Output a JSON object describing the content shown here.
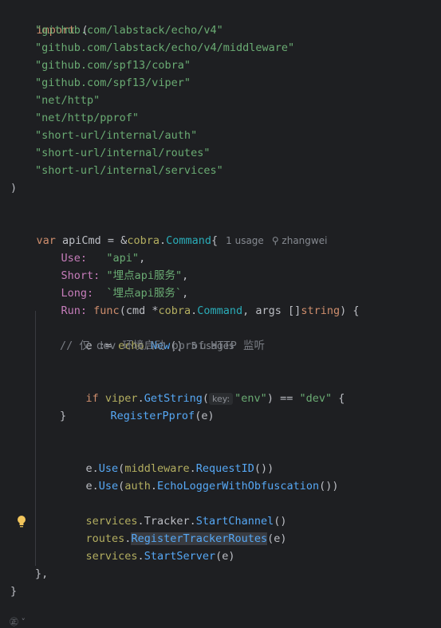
{
  "editor": {
    "lines": {
      "import_kw": "import",
      "paren_open": "(",
      "imports": [
        "\"github.com/labstack/echo/v4\"",
        "\"github.com/labstack/echo/v4/middleware\"",
        "\"github.com/spf13/cobra\"",
        "\"github.com/spf13/viper\"",
        "\"net/http\"",
        "\"net/http/pprof\"",
        "\"short-url/internal/auth\"",
        "\"short-url/internal/routes\"",
        "\"short-url/internal/services\""
      ],
      "paren_close": ")",
      "var_kw": "var",
      "var_name": " apiCmd = &",
      "cobra_pkg": "cobra",
      "dot": ".",
      "command_type": "Command",
      "brace_open": "{",
      "usage_hint": "1 usage",
      "author_hint": "zhangwei",
      "use_field": "Use:",
      "use_value": "\"api\"",
      "short_field": "Short:",
      "short_value": "\"埋点api服务\"",
      "long_field": "Long:",
      "long_value": "`埋点api服务`",
      "run_field": "Run:",
      "func_kw": "func",
      "run_sig_1": "(cmd *",
      "run_sig_2": ", args []",
      "string_kw": "string",
      "run_sig_3": ") {",
      "e_assign": "e := ",
      "echo_pkg": "echo",
      "new_fn": "New",
      "call_empty": "()",
      "usages_hint": "5 usages",
      "comment": "// 仅 dev 环境启动 pprof HTTP 监听",
      "if_kw": "if",
      "viper_pkg": "viper",
      "getstring_fn": "GetString",
      "key_hint": "key:",
      "env_str": "\"env\"",
      "eq_op": ") == ",
      "dev_str": "\"dev\"",
      "if_brace": " {",
      "register_pprof": "RegisterPprof",
      "e_arg": "(e)",
      "close_brace": "}",
      "e_use": "e.",
      "use_fn": "Use",
      "middleware_pkg": "middleware",
      "requestid_fn": "RequestID",
      "call_close2": "())",
      "auth_pkg": "auth",
      "echologger_fn": "EchoLoggerWithObfuscation",
      "services_pkg": "services",
      "tracker_field": "Tracker",
      "startchannel_fn": "StartChannel",
      "routes_pkg": "routes",
      "registertracker_fn": "RegisterTrackerRoutes",
      "startserver_fn": "StartServer",
      "func_close": "},",
      "struct_close": "}"
    },
    "bottom_indicator": "㊣ ˅"
  },
  "colors": {
    "background": "#1e1f22",
    "keyword": "#cf8e6d",
    "string": "#6aab73",
    "function": "#56a8f5",
    "package": "#b3ae60",
    "comment": "#7a7e85"
  }
}
